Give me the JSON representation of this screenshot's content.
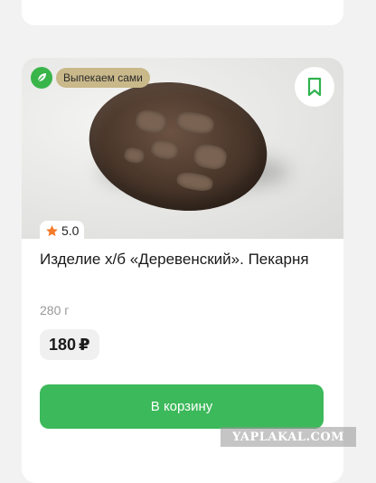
{
  "product": {
    "badge_label": "Выпекаем сами",
    "badge_icon": "leaf-icon",
    "bookmark_icon": "bookmark-icon",
    "rating": "5.0",
    "rating_icon": "star-icon",
    "title": "Изделие х/б «Деревенский». Пекарня",
    "weight": "280 г",
    "price": "180",
    "currency": "₽",
    "cart_button_label": "В корзину"
  },
  "watermark": "YAPLAKAL.COM",
  "colors": {
    "accent_green": "#3cb95a",
    "badge_gold": "#c9b88a",
    "star_orange": "#f47b2a"
  }
}
